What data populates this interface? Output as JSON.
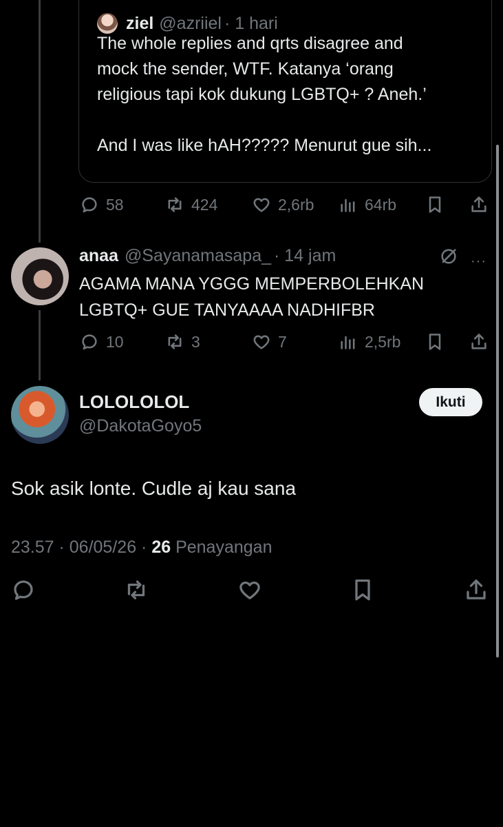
{
  "quote": {
    "name": "ziel",
    "handle": "@azriiel",
    "time": "· 1 hari",
    "text": "The whole replies and qrts disagree and\nmock the sender, WTF. Katanya ‘orang\nreligious tapi kok dukung LGBTQ+ ? Aneh.’\n\nAnd I was like hAH????? Menurut gue sih..."
  },
  "parent_actions": {
    "replies": "58",
    "reposts": "424",
    "likes": "2,6rb",
    "views": "64rb"
  },
  "reply": {
    "name": "anaa",
    "handle": "@Sayanamasapa_",
    "time": "· 14 jam",
    "text": "AGAMA MANA YGGG MEMPERBOLEHKAN LGBTQ+ GUE TANYAAAA NADHIFBR",
    "more": "···",
    "actions": {
      "replies": "10",
      "reposts": "3",
      "likes": "7",
      "views": "2,5rb"
    }
  },
  "main": {
    "name": "LOLOLOLOL",
    "handle": "@DakotaGoyo5",
    "follow_label": "Ikuti",
    "text": "Sok asik lonte. Cudle aj kau sana",
    "meta_time": "23.57 · 06/05/26 · ",
    "views_count": "26",
    "views_label": " Penayangan"
  },
  "icons": {
    "reply": "reply-icon",
    "repost": "repost-icon",
    "like": "heart-icon",
    "views": "views-icon",
    "bookmark": "bookmark-icon",
    "share": "share-icon",
    "grok": "grok-icon",
    "more": "more-icon"
  },
  "colors": {
    "background": "#000000",
    "text": "#e7e9ea",
    "muted": "#71767b",
    "border": "#2f3336",
    "follow_bg": "#eff3f4"
  }
}
